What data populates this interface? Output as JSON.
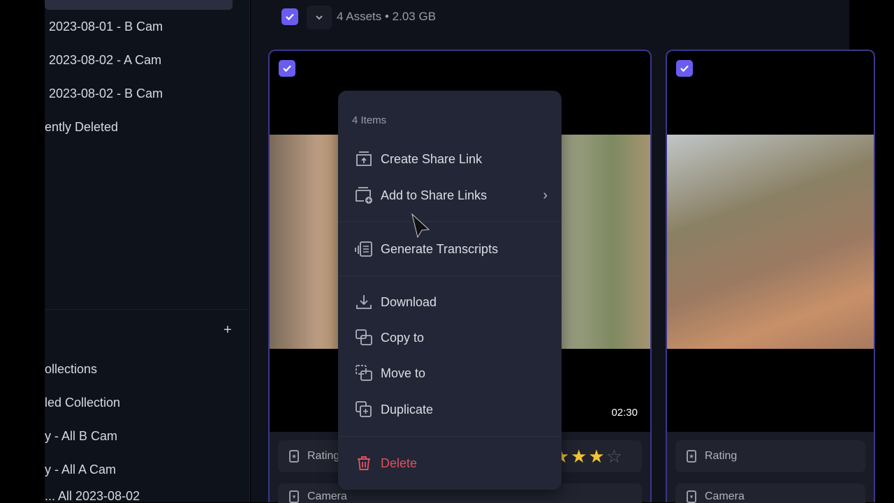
{
  "sidebar": {
    "folders": [
      "2023-08-01 - B Cam",
      "2023-08-02 - A Cam",
      "2023-08-02 - B Cam",
      "ently Deleted"
    ],
    "add_label": "+",
    "collections": [
      "ollections",
      "led Collection",
      "y - All B Cam",
      "y - All A Cam",
      "... All 2023-08-02"
    ]
  },
  "toolbar": {
    "asset_count": "4 Assets • 2.03 GB"
  },
  "cards": [
    {
      "duration": "02:30",
      "fields": [
        "Rating",
        "Camera"
      ],
      "rating": 4,
      "rating_max": 5
    },
    {
      "fields": [
        "Rating",
        "Camera"
      ]
    }
  ],
  "menu": {
    "header": "4 Items",
    "items": [
      "Create Share Link",
      "Add to Share Links",
      "Generate Transcripts",
      "Download",
      "Copy to",
      "Move to",
      "Duplicate",
      "Delete"
    ]
  },
  "colors": {
    "accent": "#6b5cf0",
    "danger": "#e0525f",
    "star": "#f5c431"
  }
}
